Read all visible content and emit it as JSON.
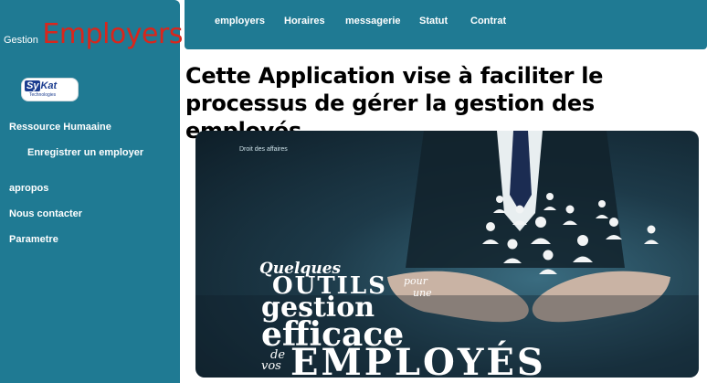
{
  "sidebar": {
    "brand_prefix": "Gestion",
    "brand_title": "Employers",
    "logo": {
      "text_a": "Sy",
      "text_b": "Kat",
      "sub": "Technologies"
    },
    "items": [
      {
        "label": "Ressource Humaaine"
      },
      {
        "label": "Enregistrer un employer"
      },
      {
        "label": "apropos"
      },
      {
        "label": "Nous contacter"
      },
      {
        "label": "Parametre"
      }
    ]
  },
  "topnav": {
    "items": [
      {
        "label": "employers"
      },
      {
        "label": "Horaires"
      },
      {
        "label": "messagerie"
      },
      {
        "label": "Statut"
      },
      {
        "label": "Contrat"
      }
    ]
  },
  "main": {
    "headline": "Cette Application vise à faciliter le processus de gérer la gestion des employés.",
    "hero": {
      "tag": "Droit des affaires",
      "line_quelques": "Quelques",
      "line_outils": "OUTILS",
      "line_pour": "pour",
      "line_une": "une",
      "line_gestion": "gestion",
      "line_efficace": "efficace",
      "line_de": "de",
      "line_vos": "vos",
      "line_employes": "EMPLOYÉS"
    }
  },
  "colors": {
    "bar": "#1f7a93",
    "brand_title": "#d9261c",
    "hero_dark": "#0e1e28"
  }
}
